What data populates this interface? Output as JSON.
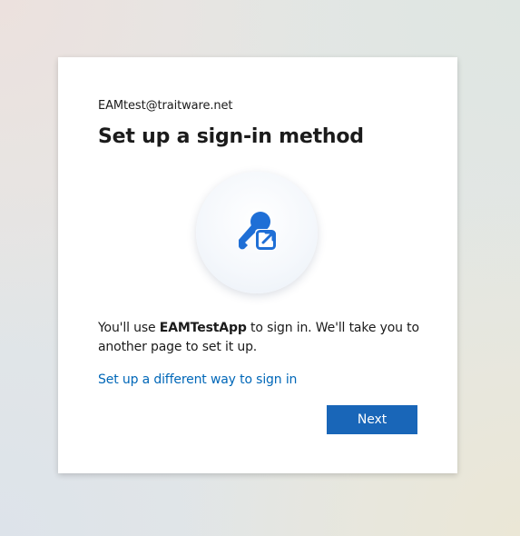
{
  "account": {
    "email": "EAMtest@traitware.net"
  },
  "title": "Set up a sign-in method",
  "icon": {
    "name": "passkey-external-icon",
    "color": "#1f6fd6"
  },
  "description": {
    "prefix": "You'll use ",
    "app_name": "EAMTestApp",
    "suffix": " to sign in. We'll take you to another page to set it up."
  },
  "links": {
    "alternate": "Set up a different way to sign in"
  },
  "actions": {
    "next_label": "Next"
  },
  "colors": {
    "accent": "#1966b8",
    "link": "#0067b8",
    "text": "#1b1b1b"
  }
}
